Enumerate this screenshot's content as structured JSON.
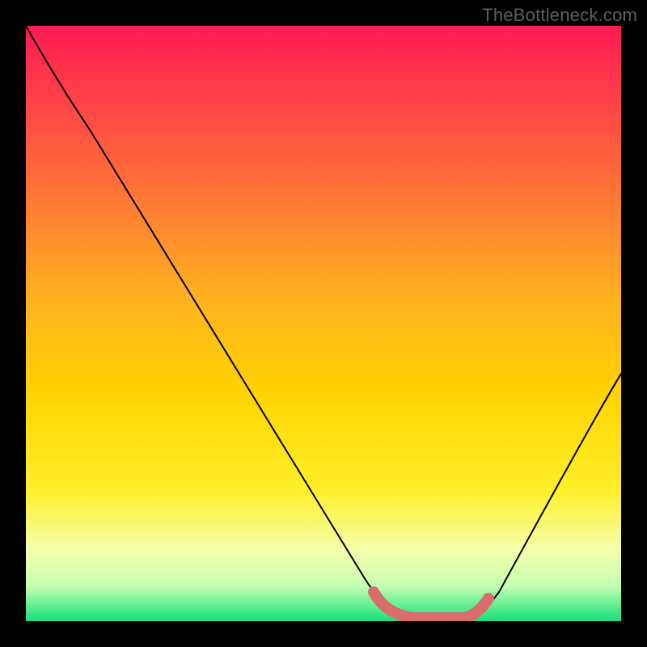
{
  "watermark": "TheBottleneck.com",
  "colors": {
    "gradient_top": "#ff1a53",
    "gradient_mid": "#ffd400",
    "gradient_low": "#f5ffab",
    "gradient_bottom": "#16e07a",
    "accent": "#d96c6c",
    "curve": "#000000",
    "frame": "#000000"
  },
  "chart_data": {
    "type": "line",
    "title": "",
    "xlabel": "",
    "ylabel": "",
    "xlim": [
      0,
      100
    ],
    "ylim": [
      0,
      100
    ],
    "x": [
      0,
      5,
      10,
      15,
      20,
      25,
      30,
      35,
      40,
      45,
      50,
      55,
      60,
      62,
      65,
      70,
      72,
      75,
      80,
      85,
      90,
      95,
      100
    ],
    "values": [
      100,
      95,
      88,
      80,
      72,
      64,
      56,
      47,
      38,
      29,
      20,
      12,
      5,
      3,
      1,
      0,
      0,
      1,
      5,
      13,
      23,
      33,
      43
    ],
    "accent_region_x": [
      60,
      74
    ],
    "annotations": []
  }
}
